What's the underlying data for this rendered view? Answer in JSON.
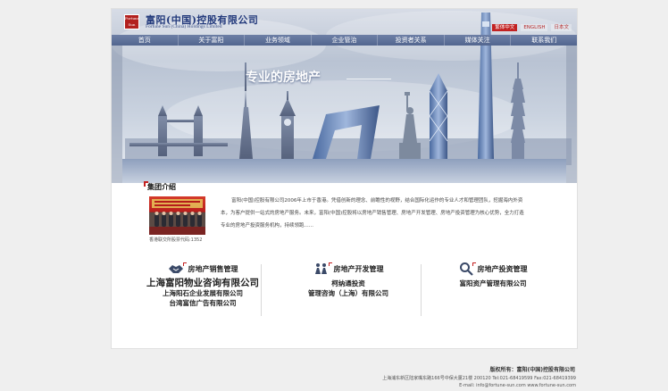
{
  "header": {
    "logo_text_top": "Fortune",
    "logo_text_bottom": "Sun",
    "brand_cn": "富阳(中国)控股有限公司",
    "brand_en": "Fortune Sun (China) Holdings Limited",
    "languages": [
      "繁体中文",
      "ENGLISH",
      "日本文"
    ]
  },
  "nav": {
    "items": [
      "首页",
      "关于富阳",
      "业务领域",
      "企业管治",
      "投资者关系",
      "媒体关注",
      "联系我们"
    ]
  },
  "hero": {
    "slogan": "专业的房地产"
  },
  "intro": {
    "title": "集团介绍",
    "photo_caption": "香港联交所股票代码:1352",
    "text": "富阳(中国)控股有限公司2006年上市于香港。凭借创新的理念、前瞻性的视野，结合国际化运作的专业人才和管理团队，挖掘海内外资本，为客户提供一站式的房地产服务。未来，富阳(中国)控股将以房地产销售管理、房地产开发管理、房地产投资管理为核心优势，全力打造专业的房地产投资服务机构，持续领跑......"
  },
  "business": [
    {
      "title": "房地产销售管理",
      "icon": "handshake-icon",
      "lines": [
        "上海富阳物业咨询有限公司",
        "上海阳石企业发展有限公司",
        "台湾富信广告有限公司"
      ]
    },
    {
      "title": "房地产开发管理",
      "icon": "team-icon",
      "lines": [
        "柯纳通投资",
        "管理咨询（上海）有限公司"
      ]
    },
    {
      "title": "房地产投资管理",
      "icon": "magnifier-icon",
      "lines": [
        "富阳资产管理有限公司"
      ]
    }
  ],
  "footer": {
    "copyright": "版权所有：富阳(中国)控股有限公司",
    "address": "上海浦东新区陆家嘴东路166号中保大厦21楼 200120 Tel:021-68419599 Fax:021-68419399",
    "email": "E-mail: info@fortune-sun.com   www.fortune-sun.com"
  },
  "colors": {
    "brand_red": "#c22222",
    "nav_blue": "#5d6f98",
    "brand_navy": "#233a7c"
  }
}
